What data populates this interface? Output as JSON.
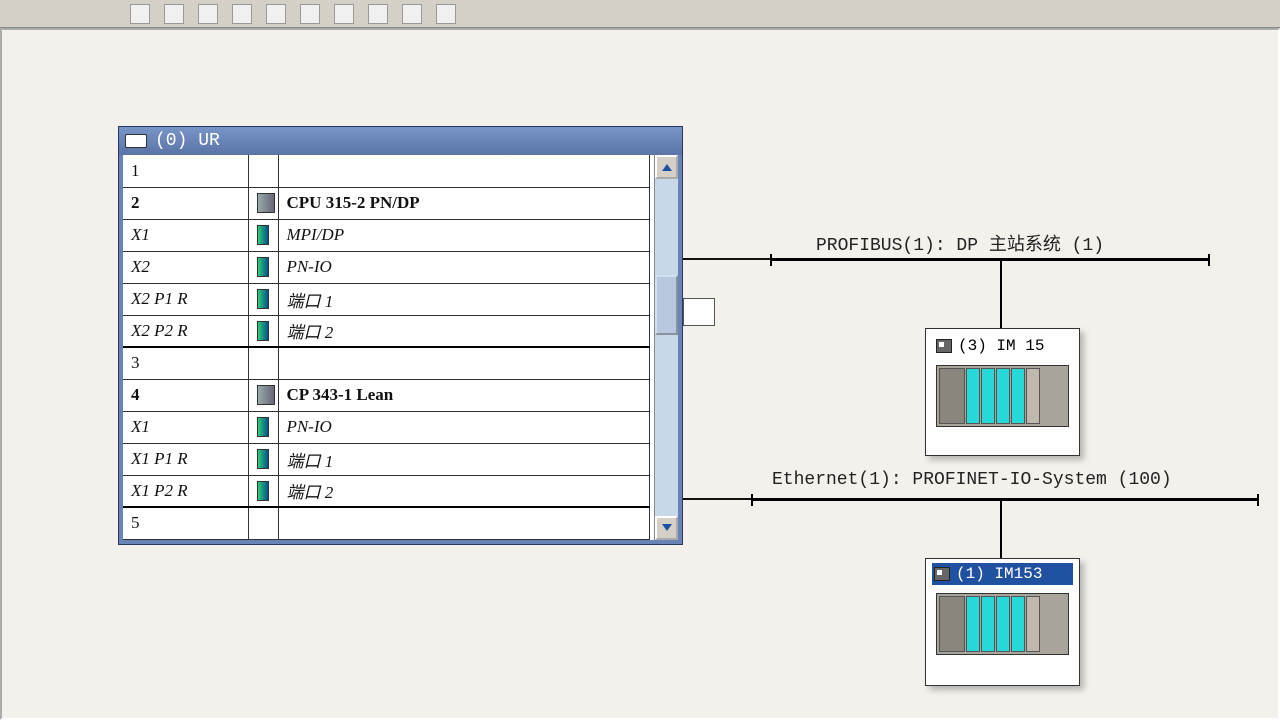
{
  "rack_window": {
    "title": "(0) UR"
  },
  "rack_rows": [
    {
      "slot": "1",
      "slot_class": "",
      "name": "",
      "name_class": "",
      "icon": "",
      "thick_top": false
    },
    {
      "slot": "2",
      "slot_class": "bold",
      "name": "CPU 315-2 PN/DP",
      "name_class": "bold",
      "icon": "big",
      "thick_top": false
    },
    {
      "slot": "X1",
      "slot_class": "italic",
      "name": "MPI/DP",
      "name_class": "italic",
      "icon": "sm",
      "thick_top": false
    },
    {
      "slot": "X2",
      "slot_class": "italic",
      "name": "PN-IO",
      "name_class": "italic",
      "icon": "sm",
      "thick_top": false
    },
    {
      "slot": "X2 P1 R",
      "slot_class": "italic",
      "name": "端口 1",
      "name_class": "italic",
      "icon": "sm",
      "thick_top": false
    },
    {
      "slot": "X2 P2 R",
      "slot_class": "italic",
      "name": "端口 2",
      "name_class": "italic",
      "icon": "sm",
      "thick_top": false
    },
    {
      "slot": "3",
      "slot_class": "",
      "name": "",
      "name_class": "",
      "icon": "",
      "thick_top": true
    },
    {
      "slot": "4",
      "slot_class": "bold",
      "name": "CP 343-1 Lean",
      "name_class": "bold",
      "icon": "big",
      "thick_top": false
    },
    {
      "slot": "X1",
      "slot_class": "italic",
      "name": "PN-IO",
      "name_class": "italic",
      "icon": "sm",
      "thick_top": false
    },
    {
      "slot": "X1 P1 R",
      "slot_class": "italic",
      "name": "端口 1",
      "name_class": "italic",
      "icon": "sm",
      "thick_top": false
    },
    {
      "slot": "X1 P2 R",
      "slot_class": "italic",
      "name": "端口 2",
      "name_class": "italic",
      "icon": "sm",
      "thick_top": false
    },
    {
      "slot": "5",
      "slot_class": "",
      "name": "",
      "name_class": "",
      "icon": "",
      "thick_top": true
    }
  ],
  "buses": {
    "profibus_label": "PROFIBUS(1): DP 主站系统 (1)",
    "ethernet_label": "Ethernet(1): PROFINET-IO-System (100)"
  },
  "devices": {
    "dev1_label": "(3) IM 15",
    "dev2_label": "(1) IM153"
  }
}
